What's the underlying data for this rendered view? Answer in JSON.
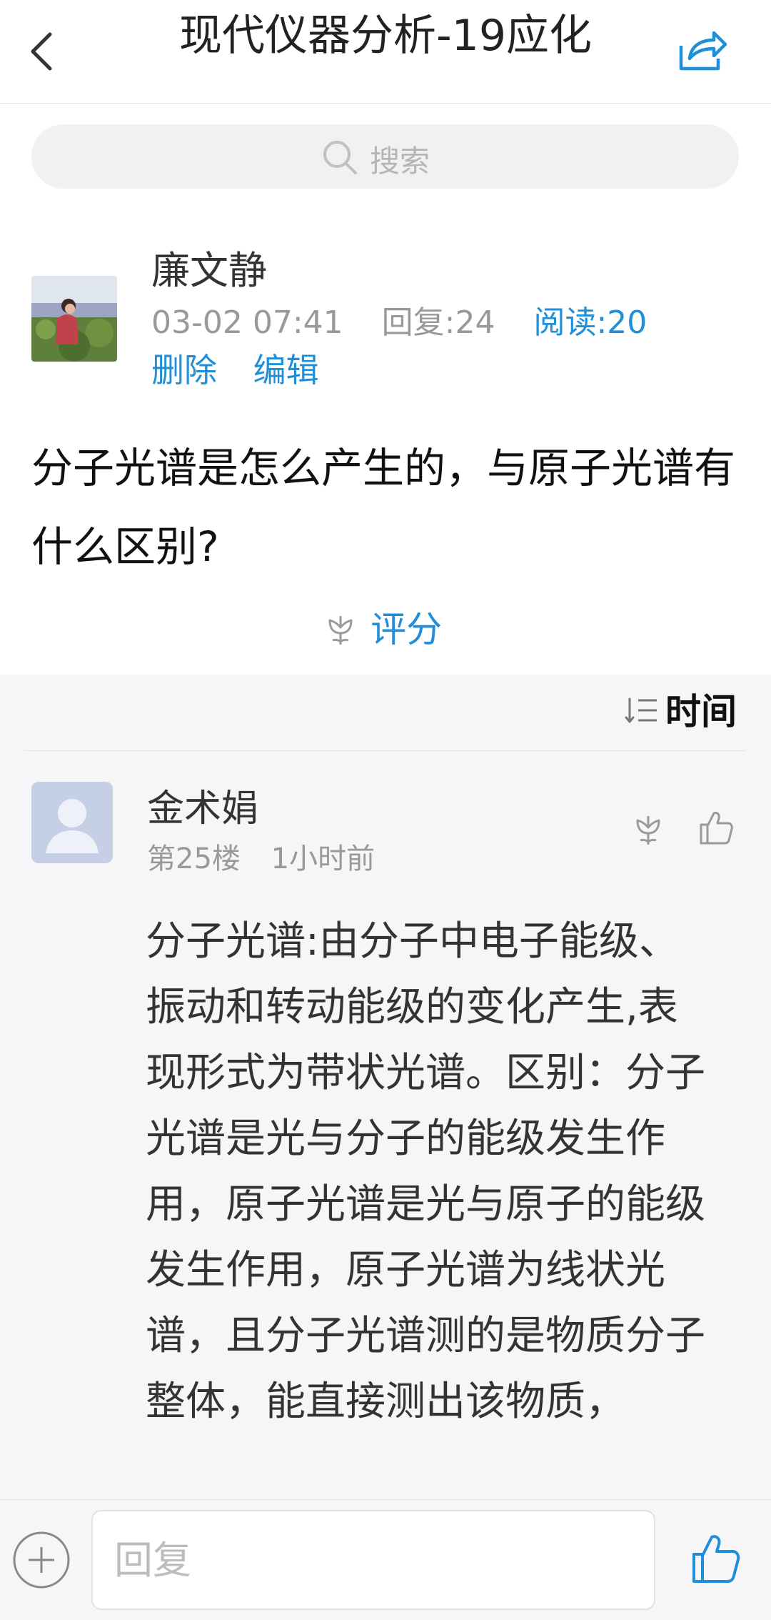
{
  "header": {
    "title": "现代仪器分析-19应化"
  },
  "search": {
    "placeholder": "搜索"
  },
  "post": {
    "author": "廉文静",
    "datetime": "03-02 07:41",
    "replies": "回复:24",
    "reads": "阅读:20",
    "actions": [
      "删除",
      "编辑"
    ],
    "question": "分子光谱是怎么产生的，与原子光谱有什么区别?",
    "rate_label": "评分"
  },
  "sort": {
    "label": "时间"
  },
  "reply": {
    "author": "金术娟",
    "floor": "第25楼",
    "time": "1小时前",
    "body": "分子光谱:由分子中电子能级、振动和转动能级的变化产生,表现形式为带状光谱。区别：分子光谱是光与分子的能级发生作用，原子光谱是光与原子的能级发生作用，原子光谱为线状光谱，且分子光谱测的是物质分子整体，能直接测出该物质，"
  },
  "bottom": {
    "reply_placeholder": "回复"
  },
  "colors": {
    "accent": "#1e8fd8",
    "meta": "#999999",
    "section_bg": "#f6f6f8"
  },
  "icons": [
    "back-arrow-icon",
    "share-icon",
    "search-icon",
    "flower-icon",
    "sort-icon",
    "thumbs-up-icon",
    "plus-icon"
  ]
}
